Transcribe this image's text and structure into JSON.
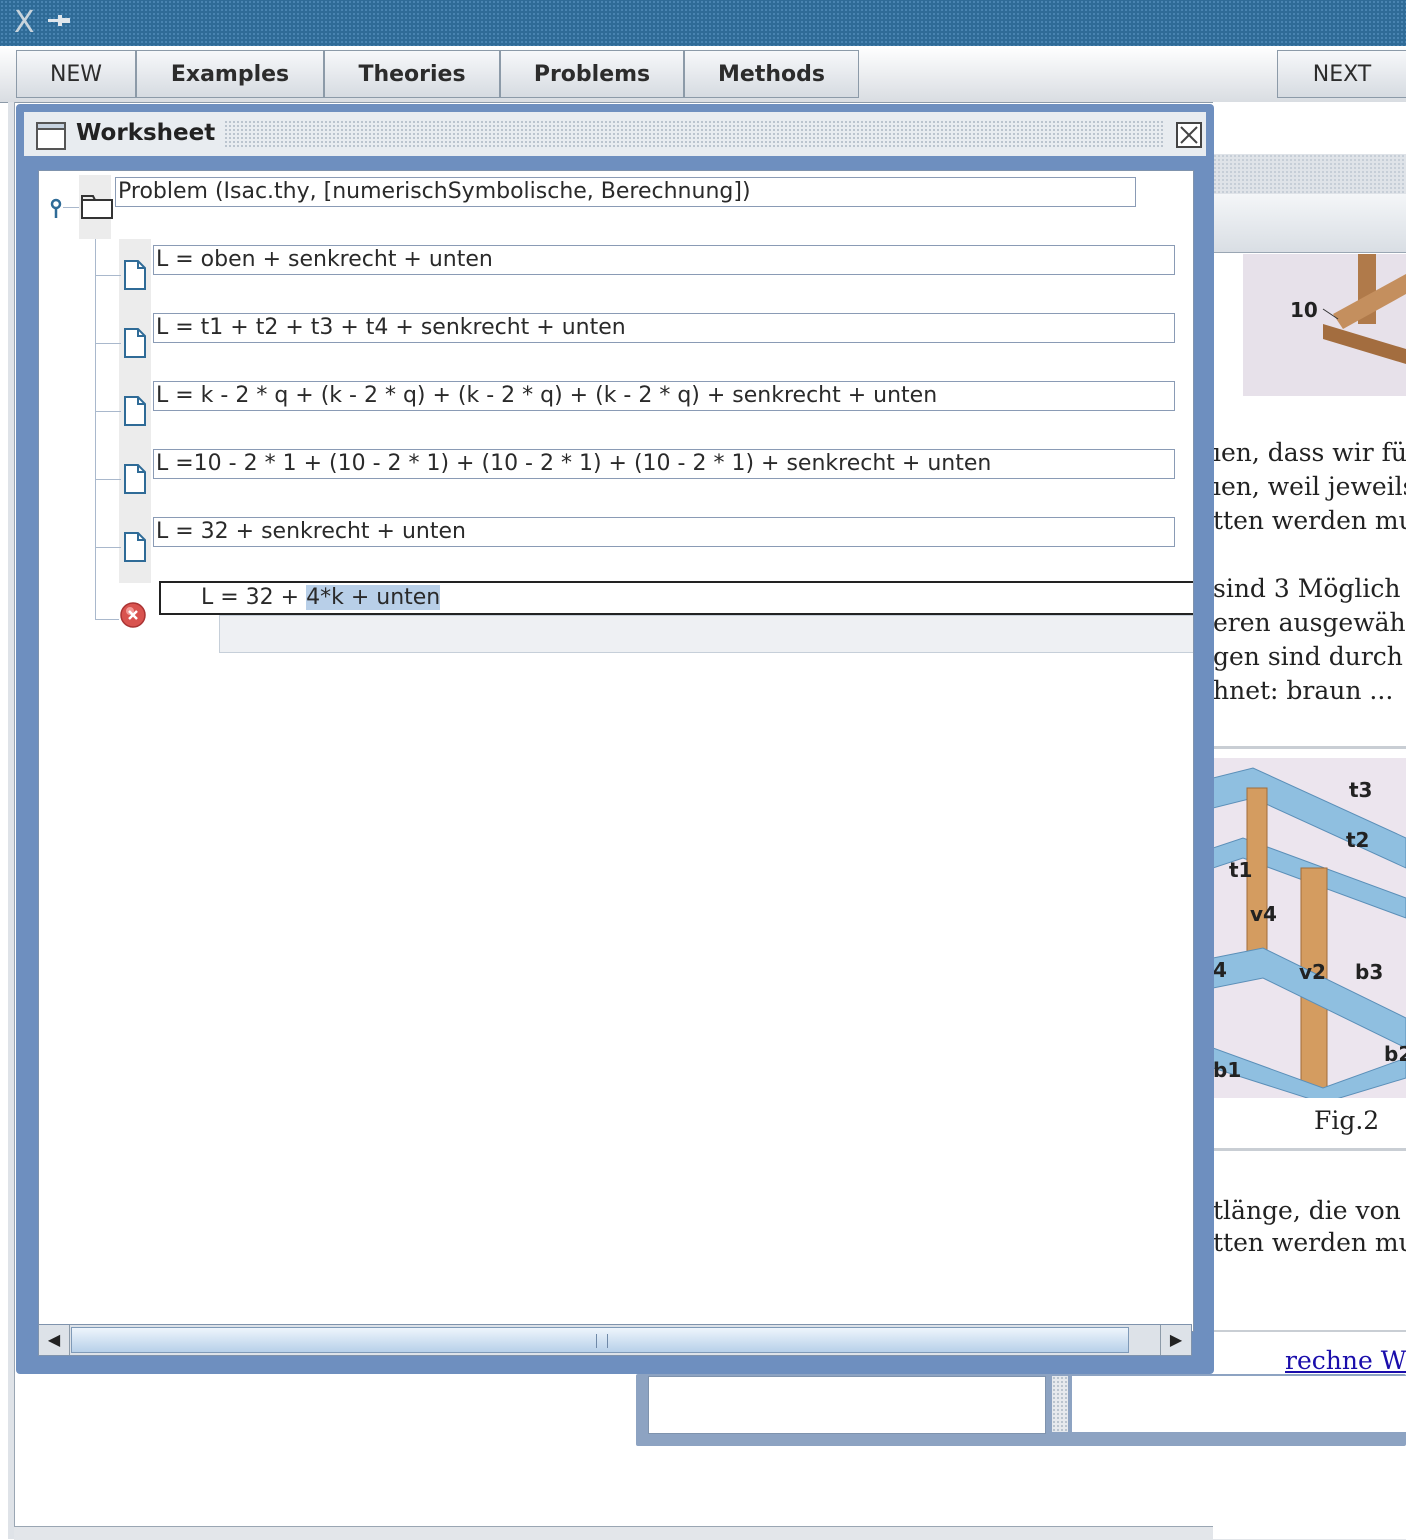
{
  "app": {
    "logo": "X"
  },
  "menu": {
    "new": "NEW",
    "examples": "Examples",
    "theories": "Theories",
    "problems": "Problems",
    "methods": "Methods",
    "next": "NEXT"
  },
  "worksheet": {
    "title": "Worksheet",
    "problem": "Problem (Isac.thy, [numerischSymbolische, Berechnung])",
    "steps": [
      "L = oben + senkrecht + unten",
      "L = t1 + t2 + t3 + t4 + senkrecht + unten",
      "L = k - 2 * q + (k - 2 * q) + (k - 2 * q) + (k - 2 * q) + senkrecht + unten",
      "L =10 - 2 * 1 + (10 - 2 * 1) + (10 - 2 * 1) + (10 - 2 * 1) + senkrecht + unten",
      "L = 32 + senkrecht + unten"
    ],
    "input": {
      "prefix": "L = 32 + ",
      "selected": "4*k + unten"
    }
  },
  "background_doc": {
    "label_10": "10",
    "lines_a": [
      "ıen, dass wir fü",
      "ıen, weil jeweils",
      "tten werden mu"
    ],
    "lines_b": [
      "sind 3 Möglich",
      "eren ausgewäh",
      "gen sind durch",
      "hnet: braun ..."
    ],
    "fig_labels": [
      "t3",
      "t2",
      "t1",
      "v4",
      "4",
      "v2",
      "b3",
      "b2",
      "b1"
    ],
    "caption": "Fig.2",
    "lines_c": [
      "tlänge, die von",
      "tten werden mu"
    ],
    "link": "rechne W"
  },
  "colors": {
    "titlebar": "#2f6b97",
    "frame": "#6e8fbf",
    "selection": "#b8cfe8",
    "error": "#d9534f",
    "link": "#1a0dab"
  }
}
